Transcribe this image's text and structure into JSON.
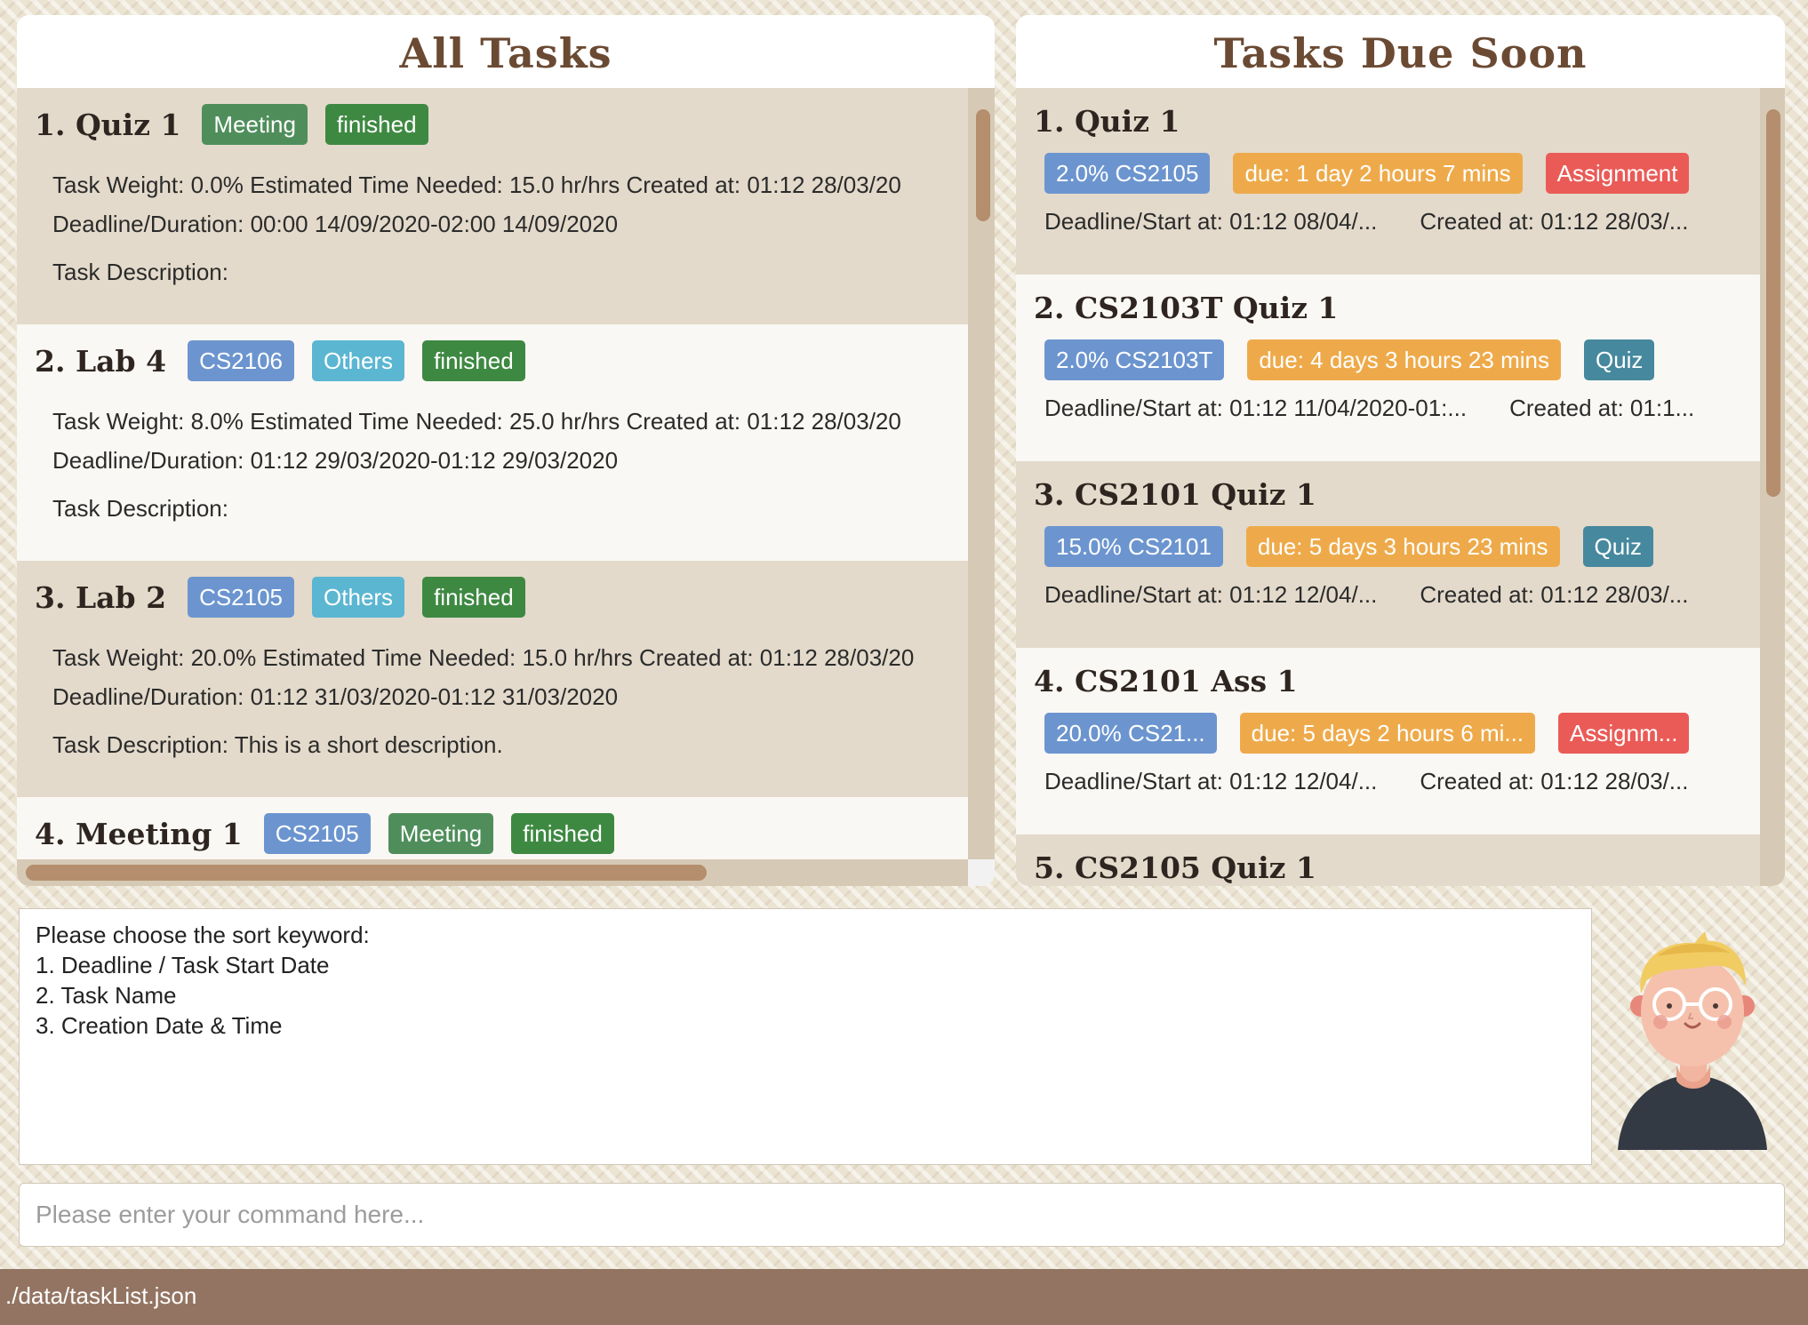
{
  "all_tasks": {
    "title": "All Tasks",
    "cards": [
      {
        "name": "1.  Quiz 1",
        "tags": [
          {
            "text": "Meeting",
            "style": "green"
          },
          {
            "text": "finished",
            "style": "dkgreen"
          }
        ],
        "line1": "Task Weight: 0.0%   Estimated Time Needed: 15.0 hr/hrs   Created at: 01:12 28/03/20",
        "line2": "Deadline/Duration: 00:00 14/09/2020-02:00 14/09/2020",
        "line3": "Task Description: "
      },
      {
        "name": "2.  Lab 4",
        "tags": [
          {
            "text": "CS2106",
            "style": "blue"
          },
          {
            "text": "Others",
            "style": "cyan"
          },
          {
            "text": "finished",
            "style": "dkgreen"
          }
        ],
        "line1": "Task Weight: 8.0%   Estimated Time Needed: 25.0 hr/hrs   Created at: 01:12 28/03/20",
        "line2": "Deadline/Duration: 01:12 29/03/2020-01:12 29/03/2020",
        "line3": "Task Description: "
      },
      {
        "name": "3.  Lab 2",
        "tags": [
          {
            "text": "CS2105",
            "style": "blue"
          },
          {
            "text": "Others",
            "style": "cyan"
          },
          {
            "text": "finished",
            "style": "dkgreen"
          }
        ],
        "line1": "Task Weight: 20.0%   Estimated Time Needed: 15.0 hr/hrs   Created at: 01:12 28/03/20",
        "line2": "Deadline/Duration: 01:12 31/03/2020-01:12 31/03/2020",
        "line3": "Task Description: This is a short description."
      },
      {
        "name": "4.  Meeting 1",
        "tags": [
          {
            "text": "CS2105",
            "style": "blue"
          },
          {
            "text": "Meeting",
            "style": "green"
          },
          {
            "text": "finished",
            "style": "dkgreen"
          }
        ],
        "line1": "",
        "line2": "",
        "line3": ""
      }
    ]
  },
  "due_soon": {
    "title": "Tasks Due Soon",
    "cards": [
      {
        "name": "1.  Quiz 1",
        "tags": [
          {
            "text": "2.0% CS2105",
            "style": "blue"
          },
          {
            "text": "due: 1 day 2 hours 7 mins",
            "style": "orange"
          },
          {
            "text": "Assignment",
            "style": "red"
          }
        ],
        "deadline": "Deadline/Start at: 01:12 08/04/...",
        "created": "Created at: 01:12 28/03/..."
      },
      {
        "name": "2.  CS2103T Quiz 1",
        "tags": [
          {
            "text": "2.0% CS2103T",
            "style": "blue"
          },
          {
            "text": "due: 4 days 3 hours 23 mins",
            "style": "orange"
          },
          {
            "text": "Quiz",
            "style": "teal"
          }
        ],
        "deadline": "Deadline/Start at: 01:12 11/04/2020-01:...",
        "created": "Created at: 01:1..."
      },
      {
        "name": "3.  CS2101 Quiz 1",
        "tags": [
          {
            "text": "15.0% CS2101",
            "style": "blue"
          },
          {
            "text": "due: 5 days 3 hours 23 mins",
            "style": "orange"
          },
          {
            "text": "Quiz",
            "style": "teal"
          }
        ],
        "deadline": "Deadline/Start at: 01:12 12/04/...",
        "created": "Created at: 01:12 28/03/..."
      },
      {
        "name": "4.  CS2101 Ass 1",
        "tags": [
          {
            "text": "20.0% CS21...",
            "style": "blue"
          },
          {
            "text": "due: 5 days 2 hours 6 mi...",
            "style": "orange"
          },
          {
            "text": "Assignm...",
            "style": "red"
          }
        ],
        "deadline": "Deadline/Start at: 01:12 12/04/...",
        "created": "Created at: 01:12 28/03/..."
      },
      {
        "name": "5.  CS2105 Quiz 1",
        "tags": [],
        "deadline": "",
        "created": ""
      }
    ]
  },
  "result": {
    "lines": [
      "Please choose the sort keyword:",
      "1. Deadline / Task Start Date",
      "2. Task Name",
      "3. Creation Date & Time"
    ]
  },
  "command": {
    "placeholder": "Please enter your command here...",
    "value": ""
  },
  "status_bar": {
    "path": "./data/taskList.json"
  },
  "colors": {
    "title_brown": "#6b4a33",
    "tag_blue": "#6c95cf",
    "tag_orange": "#eeaa4a",
    "tag_red": "#ea5b57",
    "tag_teal": "#46889e",
    "tag_green": "#4f8e5b",
    "status_bar": "#937462"
  }
}
